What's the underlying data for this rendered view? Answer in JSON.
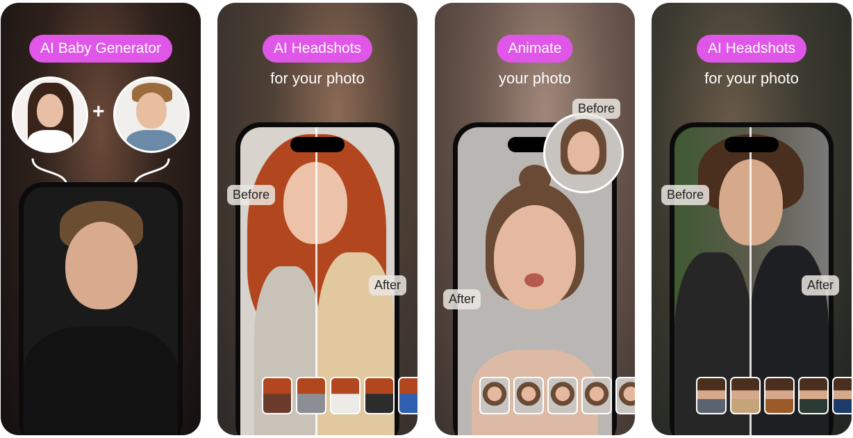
{
  "cards": [
    {
      "badge": "AI Baby Generator",
      "plus": "+"
    },
    {
      "badge": "AI Headshots",
      "subtitle": "for your photo",
      "before": "Before",
      "after": "After"
    },
    {
      "badge": "Animate",
      "subtitle": "your photo",
      "before": "Before",
      "after": "After"
    },
    {
      "badge": "AI Headshots",
      "subtitle": "for your photo",
      "before": "Before",
      "after": "After"
    }
  ],
  "colors": {
    "badge": "#e056e8",
    "label_bg": "#ebe6e1",
    "text": "#ffffff"
  },
  "icons": [
    "plus-icon",
    "curved-arrow-icon"
  ]
}
